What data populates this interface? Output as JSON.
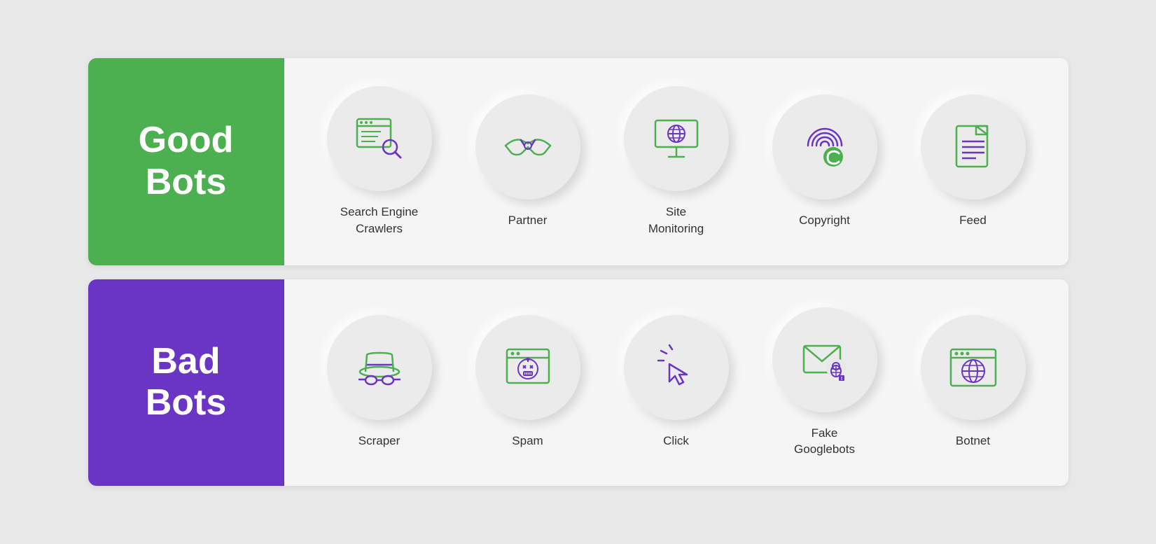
{
  "good_bots": {
    "label_line1": "Good",
    "label_line2": "Bots",
    "items": [
      {
        "id": "search-engine-crawlers",
        "label": "Search Engine\nCrawlers"
      },
      {
        "id": "partner",
        "label": "Partner"
      },
      {
        "id": "site-monitoring",
        "label": "Site\nMonitoring"
      },
      {
        "id": "copyright",
        "label": "Copyright"
      },
      {
        "id": "feed",
        "label": "Feed"
      }
    ]
  },
  "bad_bots": {
    "label_line1": "Bad",
    "label_line2": "Bots",
    "items": [
      {
        "id": "scraper",
        "label": "Scraper"
      },
      {
        "id": "spam",
        "label": "Spam"
      },
      {
        "id": "click",
        "label": "Click"
      },
      {
        "id": "fake-googlebots",
        "label": "Fake\nGooglebots"
      },
      {
        "id": "botnet",
        "label": "Botnet"
      }
    ]
  },
  "colors": {
    "good_green": "#4caf50",
    "bad_purple": "#6a35c4",
    "icon_green": "#4caf50",
    "icon_purple": "#6a35c4"
  }
}
